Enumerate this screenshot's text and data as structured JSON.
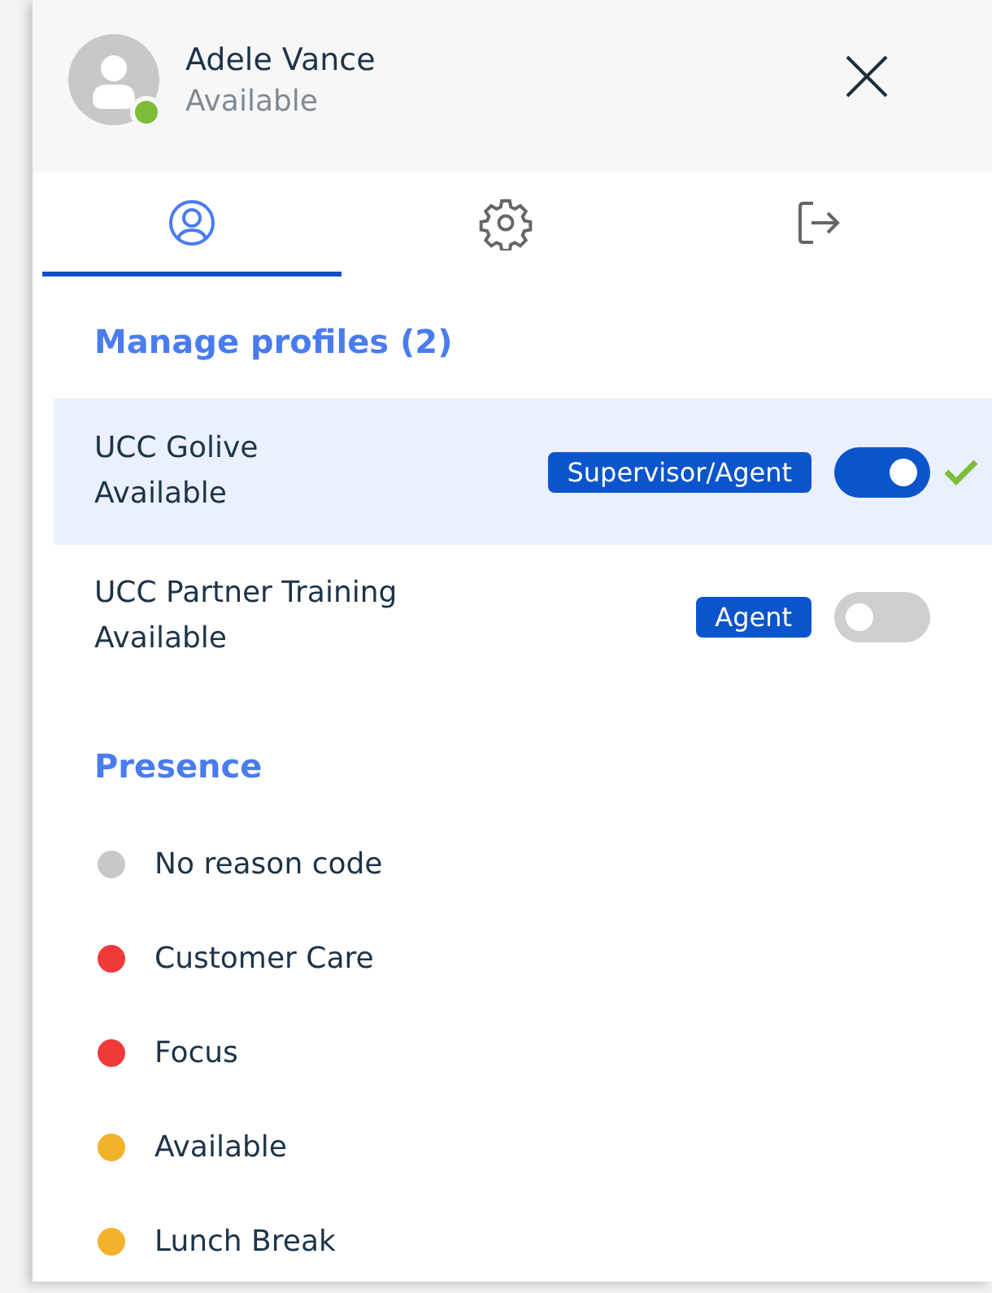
{
  "user": {
    "name": "Adele Vance",
    "status": "Available",
    "online": true
  },
  "tabs": [
    {
      "kind": "profile",
      "selected": true
    },
    {
      "kind": "settings",
      "selected": false
    },
    {
      "kind": "signout",
      "selected": false
    }
  ],
  "profiles_heading": "Manage profiles (2)",
  "profiles": [
    {
      "name": "UCC Golive",
      "status": "Available",
      "role": "Supervisor/Agent",
      "on": true,
      "selected": true
    },
    {
      "name": "UCC Partner Training",
      "status": "Available",
      "role": "Agent",
      "on": false,
      "selected": false
    }
  ],
  "presence_heading": "Presence",
  "presence": [
    {
      "label": "No reason code",
      "color": "#c8c8c8"
    },
    {
      "label": "Customer Care",
      "color": "#f03a3a"
    },
    {
      "label": "Focus",
      "color": "#f03a3a"
    },
    {
      "label": "Available",
      "color": "#f2b22b"
    },
    {
      "label": "Lunch Break",
      "color": "#f2b22b"
    }
  ]
}
